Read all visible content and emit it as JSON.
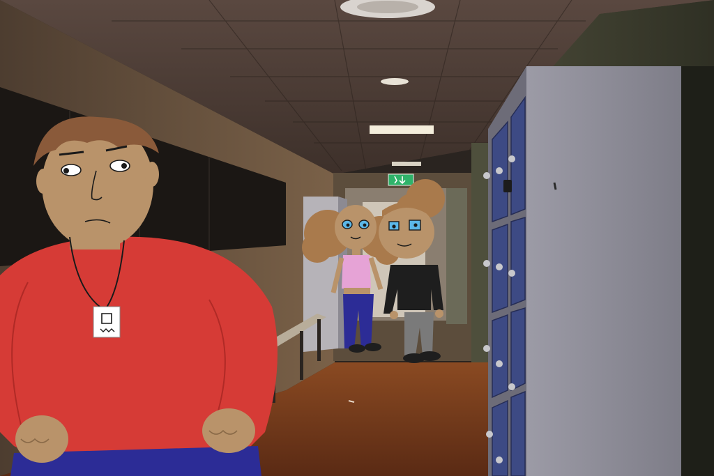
{
  "scene": {
    "setting": "school-hallway",
    "exit_sign_present": true
  },
  "colors": {
    "ceiling": "#4a3a32",
    "wall_left": "#5e4b3a",
    "wall_right": "#3f4030",
    "floor": "#7a3c1c",
    "locker_body": "#8e8d9a",
    "locker_door": "#3e4b86",
    "sign_green": "#2fb36a",
    "shirt_red": "#d63b36",
    "skin": "#b9936a",
    "hair": "#8a5a3a",
    "pants_blue": "#2c2c96",
    "top_pink": "#e6a3d6",
    "sweater_black": "#1e1e1e",
    "pants_grey": "#7a7a7a"
  },
  "characters": [
    {
      "role": "foreground-boy",
      "shirt": "red",
      "accessory": "lanyard-badge"
    },
    {
      "role": "girl-curly-hair",
      "top": "pink",
      "pants": "blue"
    },
    {
      "role": "boy-bun-hair",
      "top": "black",
      "pants": "grey"
    }
  ]
}
